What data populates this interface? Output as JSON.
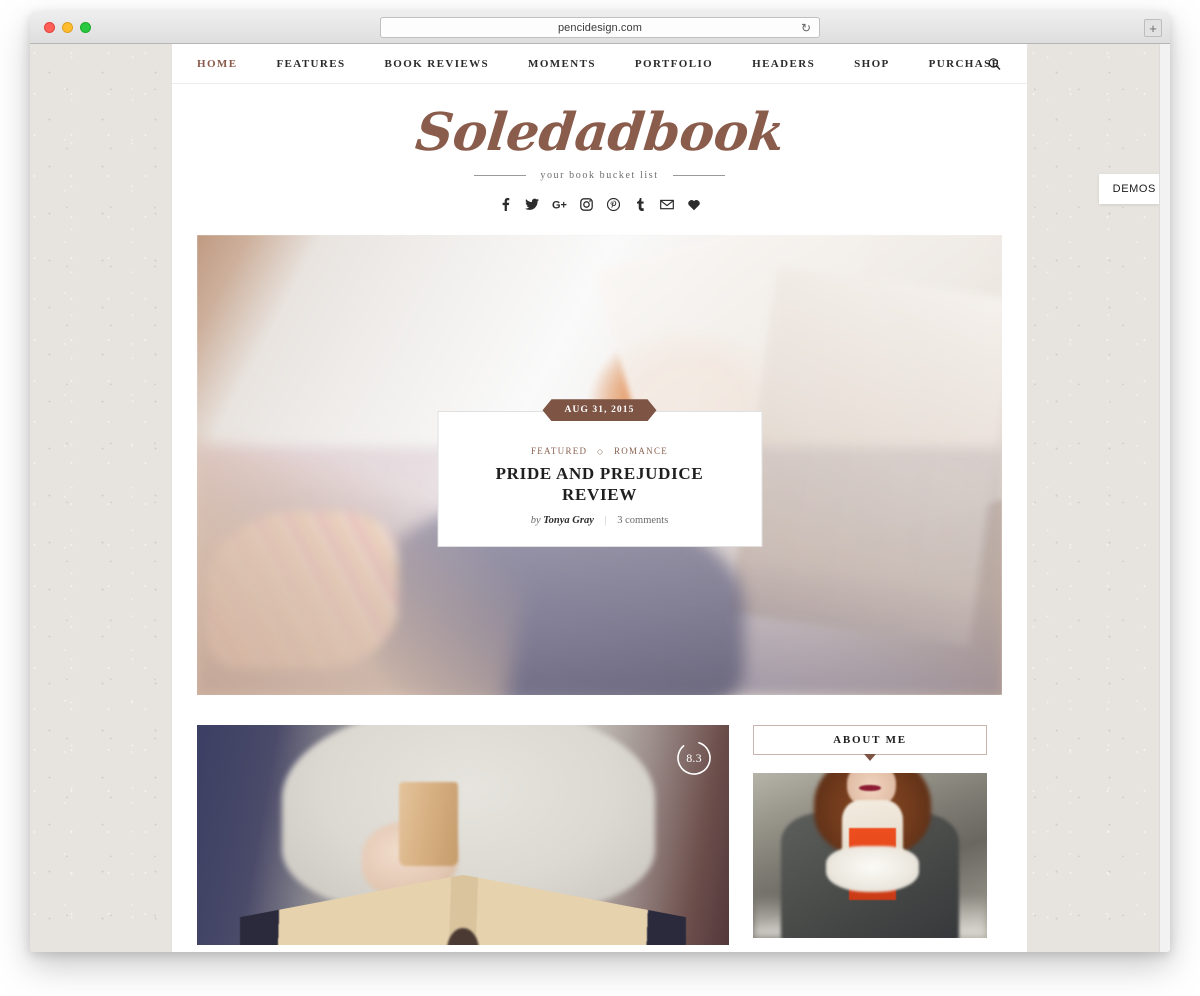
{
  "browser": {
    "url": "pencidesign.com",
    "reload_icon": "reload-icon",
    "new_tab_label": "+",
    "traffic_lights": [
      "close",
      "minimize",
      "maximize"
    ]
  },
  "demos_tab": {
    "label": "DEMOS"
  },
  "nav": {
    "items": [
      {
        "label": "HOME",
        "active": true
      },
      {
        "label": "FEATURES",
        "active": false
      },
      {
        "label": "BOOK REVIEWS",
        "active": false
      },
      {
        "label": "MOMENTS",
        "active": false
      },
      {
        "label": "PORTFOLIO",
        "active": false
      },
      {
        "label": "HEADERS",
        "active": false
      },
      {
        "label": "SHOP",
        "active": false
      },
      {
        "label": "PURCHASE",
        "active": false
      }
    ],
    "search_icon": "search-icon"
  },
  "branding": {
    "logo": "Soledadbook",
    "tagline": "your book bucket list",
    "social": [
      {
        "name": "facebook-icon",
        "glyph": "f"
      },
      {
        "name": "twitter-icon",
        "glyph": "t"
      },
      {
        "name": "google-plus-icon",
        "glyph": "G+"
      },
      {
        "name": "instagram-icon",
        "glyph": "ig"
      },
      {
        "name": "pinterest-icon",
        "glyph": "P"
      },
      {
        "name": "tumblr-icon",
        "glyph": "t"
      },
      {
        "name": "email-icon",
        "glyph": "mail"
      },
      {
        "name": "bloglovin-heart-icon",
        "glyph": "heart"
      }
    ]
  },
  "featured_post": {
    "date": "AUG 31, 2015",
    "categories": [
      "FEATURED",
      "ROMANCE"
    ],
    "category_separator": "◇",
    "title": "PRIDE AND PREJUDICE REVIEW",
    "by_label": "by",
    "author": "Tonya Gray",
    "meta_separator": "|",
    "comments": "3 comments"
  },
  "second_post": {
    "score": "8.3"
  },
  "sidebar": {
    "widgets": [
      {
        "title": "ABOUT ME"
      }
    ]
  },
  "colors": {
    "accent_brown": "#7e5444",
    "logo_brown": "#8a5c4c",
    "site_background": "#e7e4df",
    "content_background": "#ffffff",
    "nav_text": "#2b2b2b"
  }
}
